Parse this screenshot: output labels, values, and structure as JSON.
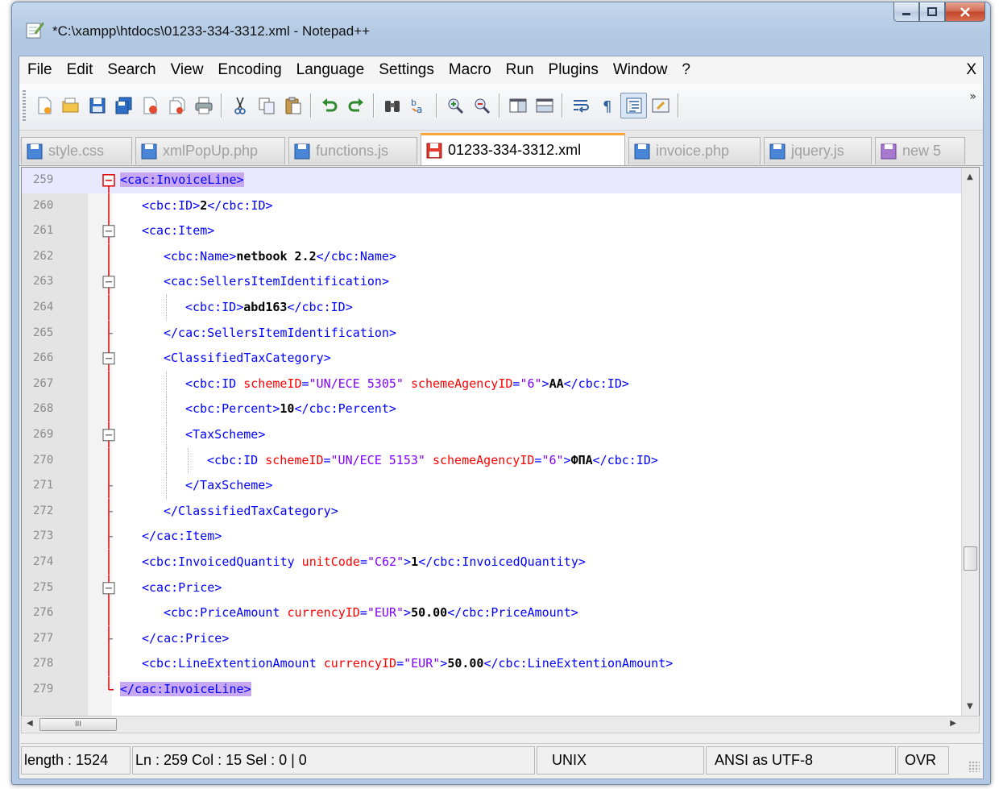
{
  "window": {
    "title": "*C:\\xampp\\htdocs\\01233-334-3312.xml - Notepad++"
  },
  "menu": {
    "items": [
      "File",
      "Edit",
      "Search",
      "View",
      "Encoding",
      "Language",
      "Settings",
      "Macro",
      "Run",
      "Plugins",
      "Window",
      "?"
    ],
    "close_label": "X"
  },
  "toolbar": {
    "more_label": "»",
    "buttons": [
      "new-file",
      "open-file",
      "save",
      "save-all",
      "close",
      "close-all",
      "print",
      "cut",
      "copy",
      "paste",
      "undo",
      "redo",
      "find",
      "replace",
      "zoom-in",
      "zoom-out",
      "sync-vertical",
      "sync-horizontal",
      "word-wrap",
      "show-all-characters",
      "indent-guide",
      "user-defined-language"
    ]
  },
  "tabs": [
    {
      "label": "style.css",
      "active": false,
      "icon": "saved-disk-icon"
    },
    {
      "label": "xmlPopUp.php",
      "active": false,
      "icon": "saved-disk-icon"
    },
    {
      "label": "functions.js",
      "active": false,
      "icon": "saved-disk-icon"
    },
    {
      "label": "01233-334-3312.xml",
      "active": true,
      "icon": "unsaved-disk-icon"
    },
    {
      "label": "invoice.php",
      "active": false,
      "icon": "saved-disk-icon"
    },
    {
      "label": "jquery.js",
      "active": false,
      "icon": "saved-disk-icon"
    },
    {
      "label": "new 5",
      "active": false,
      "icon": "new-disk-icon"
    }
  ],
  "editor": {
    "lines": [
      {
        "num": "259",
        "text": "<cac:InvoiceLine>"
      },
      {
        "num": "260",
        "text": "<cbc:ID>2</cbc:ID>"
      },
      {
        "num": "261",
        "text": "<cac:Item>"
      },
      {
        "num": "262",
        "text": "<cbc:Name>netbook 2.2</cbc:Name>"
      },
      {
        "num": "263",
        "text": "<cac:SellersItemIdentification>"
      },
      {
        "num": "264",
        "text": "<cbc:ID>abd163</cbc:ID>"
      },
      {
        "num": "265",
        "text": "</cac:SellersItemIdentification>"
      },
      {
        "num": "266",
        "text": "<ClassifiedTaxCategory>"
      },
      {
        "num": "267",
        "text": "<cbc:ID schemeID=\"UN/ECE 5305\" schemeAgencyID=\"6\">AA</cbc:ID>"
      },
      {
        "num": "268",
        "text": "<cbc:Percent>10</cbc:Percent>"
      },
      {
        "num": "269",
        "text": "<TaxScheme>"
      },
      {
        "num": "270",
        "text": "<cbc:ID schemeID=\"UN/ECE 5153\" schemeAgencyID=\"6\">ФПА</cbc:ID>"
      },
      {
        "num": "271",
        "text": "</TaxScheme>"
      },
      {
        "num": "272",
        "text": "</ClassifiedTaxCategory>"
      },
      {
        "num": "273",
        "text": "</cac:Item>"
      },
      {
        "num": "274",
        "text": "<cbc:InvoicedQuantity unitCode=\"C62\">1</cbc:InvoicedQuantity>"
      },
      {
        "num": "275",
        "text": "<cac:Price>"
      },
      {
        "num": "276",
        "text": "<cbc:PriceAmount currencyID=\"EUR\">50.00</cbc:PriceAmount>"
      },
      {
        "num": "277",
        "text": "</cac:Price>"
      },
      {
        "num": "278",
        "text": "<cbc:LineExtentionAmount currencyID=\"EUR\">50.00</cbc:LineExtentionAmount>"
      },
      {
        "num": "279",
        "text": "</cac:InvoiceLine>"
      }
    ]
  },
  "hscroll": {
    "grip_label": "III"
  },
  "status": {
    "length": "length : 1524",
    "position": "Ln : 259    Col : 15    Sel : 0 | 0",
    "eol": "UNIX",
    "encoding": "ANSI as UTF-8",
    "mode": "OVR"
  },
  "colors": {
    "tag": "#0000ff",
    "attribute": "#ff0000",
    "attribute_value": "#8000ff",
    "fold_marker": "#e00000",
    "active_tab_accent": "#faa63a",
    "bracket_highlight": "#c8a8f0"
  }
}
